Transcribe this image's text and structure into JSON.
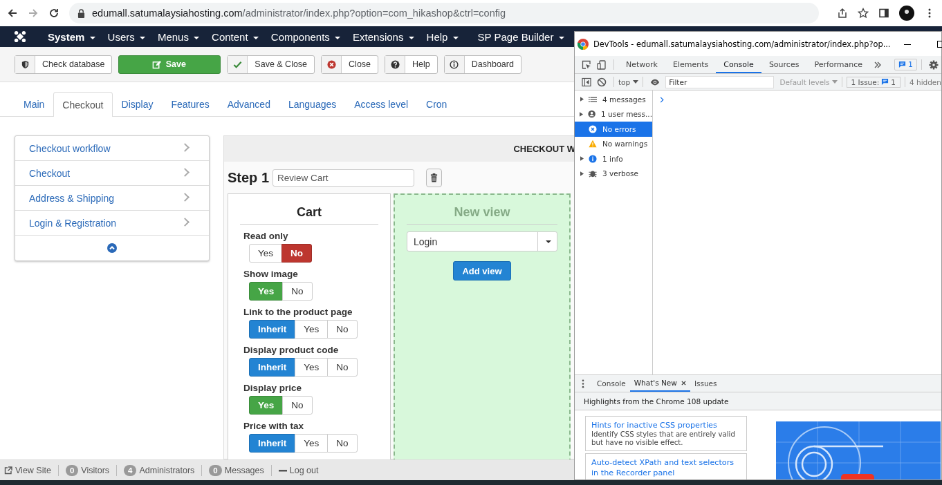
{
  "browser": {
    "url_domain": "edumall.satumalaysiahosting.com",
    "url_path": "/administrator/index.php?option=com_hikashop&ctrl=config"
  },
  "navbar": {
    "items": [
      "System",
      "Users",
      "Menus",
      "Content",
      "Components",
      "Extensions",
      "Help",
      "SP Page Builder"
    ]
  },
  "toolbar": [
    {
      "label": "Check database",
      "kind": "shield"
    },
    {
      "label": "Save",
      "kind": "save"
    },
    {
      "label": "Save & Close",
      "kind": "check"
    },
    {
      "label": "Close",
      "kind": "close"
    },
    {
      "label": "Help",
      "kind": "help"
    },
    {
      "label": "Dashboard",
      "kind": "info"
    }
  ],
  "tabs": [
    {
      "label": "Main",
      "selected": false
    },
    {
      "label": "Checkout",
      "selected": true
    },
    {
      "label": "Display",
      "selected": false
    },
    {
      "label": "Features",
      "selected": false
    },
    {
      "label": "Advanced",
      "selected": false
    },
    {
      "label": "Languages",
      "selected": false
    },
    {
      "label": "Access level",
      "selected": false
    },
    {
      "label": "Cron",
      "selected": false
    }
  ],
  "sidebar": {
    "items": [
      "Checkout workflow",
      "Checkout",
      "Address & Shipping",
      "Login & Registration"
    ]
  },
  "workflow": {
    "heading": "CHECKOUT W",
    "step_label": "Step 1",
    "step_name": "Review Cart",
    "cart": {
      "title": "Cart",
      "settings": [
        {
          "label": "Read only",
          "options": [
            {
              "label": "Yes",
              "kind": "yes",
              "selected": false
            },
            {
              "label": "No",
              "kind": "no",
              "selected": true
            }
          ]
        },
        {
          "label": "Show image",
          "options": [
            {
              "label": "Yes",
              "kind": "yes",
              "selected": true
            },
            {
              "label": "No",
              "kind": "no",
              "selected": false
            }
          ]
        },
        {
          "label": "Link to the product page",
          "options": [
            {
              "label": "Inherit",
              "kind": "inherit",
              "selected": true
            },
            {
              "label": "Yes",
              "kind": "yes",
              "selected": false
            },
            {
              "label": "No",
              "kind": "no",
              "selected": false
            }
          ]
        },
        {
          "label": "Display product code",
          "options": [
            {
              "label": "Inherit",
              "kind": "inherit",
              "selected": true
            },
            {
              "label": "Yes",
              "kind": "yes",
              "selected": false
            },
            {
              "label": "No",
              "kind": "no",
              "selected": false
            }
          ]
        },
        {
          "label": "Display price",
          "options": [
            {
              "label": "Yes",
              "kind": "yes",
              "selected": true
            },
            {
              "label": "No",
              "kind": "no",
              "selected": false
            }
          ]
        },
        {
          "label": "Price with tax",
          "options": [
            {
              "label": "Inherit",
              "kind": "inherit",
              "selected": true
            },
            {
              "label": "Yes",
              "kind": "yes",
              "selected": false
            },
            {
              "label": "No",
              "kind": "no",
              "selected": false
            }
          ]
        }
      ]
    },
    "new_view": {
      "title": "New view",
      "select_value": "Login",
      "button": "Add view"
    }
  },
  "status_bar": [
    {
      "label": "View Site",
      "kind": "link"
    },
    {
      "count": "0",
      "label": "Visitors",
      "kind": "count"
    },
    {
      "count": "4",
      "label": "Administrators",
      "kind": "count"
    },
    {
      "count": "0",
      "label": "Messages",
      "kind": "count"
    },
    {
      "label": "Log out",
      "kind": "logout"
    }
  ],
  "devtools": {
    "title": "DevTools - edumall.satumalaysiahosting.com/administrator/index.php?op...",
    "tabs": [
      {
        "label": "Network",
        "selected": false
      },
      {
        "label": "Elements",
        "selected": false
      },
      {
        "label": "Console",
        "selected": true
      },
      {
        "label": "Sources",
        "selected": false
      },
      {
        "label": "Performance",
        "selected": false
      }
    ],
    "issues_badge": "1",
    "context": "top",
    "filter_placeholder": "Filter",
    "levels": "Default levels",
    "issue_label": "1 Issue:",
    "issue_count": "1",
    "hidden": "4 hidden",
    "sidebar": [
      {
        "label": "4 messages",
        "kind": "list",
        "expandable": true,
        "selected": false
      },
      {
        "label": "1 user mess...",
        "kind": "user",
        "expandable": true,
        "selected": false
      },
      {
        "label": "No errors",
        "kind": "error",
        "expandable": false,
        "selected": true
      },
      {
        "label": "No warnings",
        "kind": "warning",
        "expandable": false,
        "selected": false
      },
      {
        "label": "1 info",
        "kind": "info",
        "expandable": true,
        "selected": false
      },
      {
        "label": "3 verbose",
        "kind": "verbose",
        "expandable": true,
        "selected": false
      }
    ],
    "drawer_tabs": [
      {
        "label": "Console",
        "selected": false,
        "closable": false
      },
      {
        "label": "What's New",
        "selected": true,
        "closable": true
      },
      {
        "label": "Issues",
        "selected": false,
        "closable": false
      }
    ],
    "drawer_heading": "Highlights from the Chrome 108 update",
    "cards": [
      {
        "title": "Hints for inactive CSS properties",
        "text": "Identify CSS styles that are entirely valid but have no visible effect."
      },
      {
        "title": "Auto-detect XPath and text selectors in the Recorder panel"
      }
    ]
  }
}
